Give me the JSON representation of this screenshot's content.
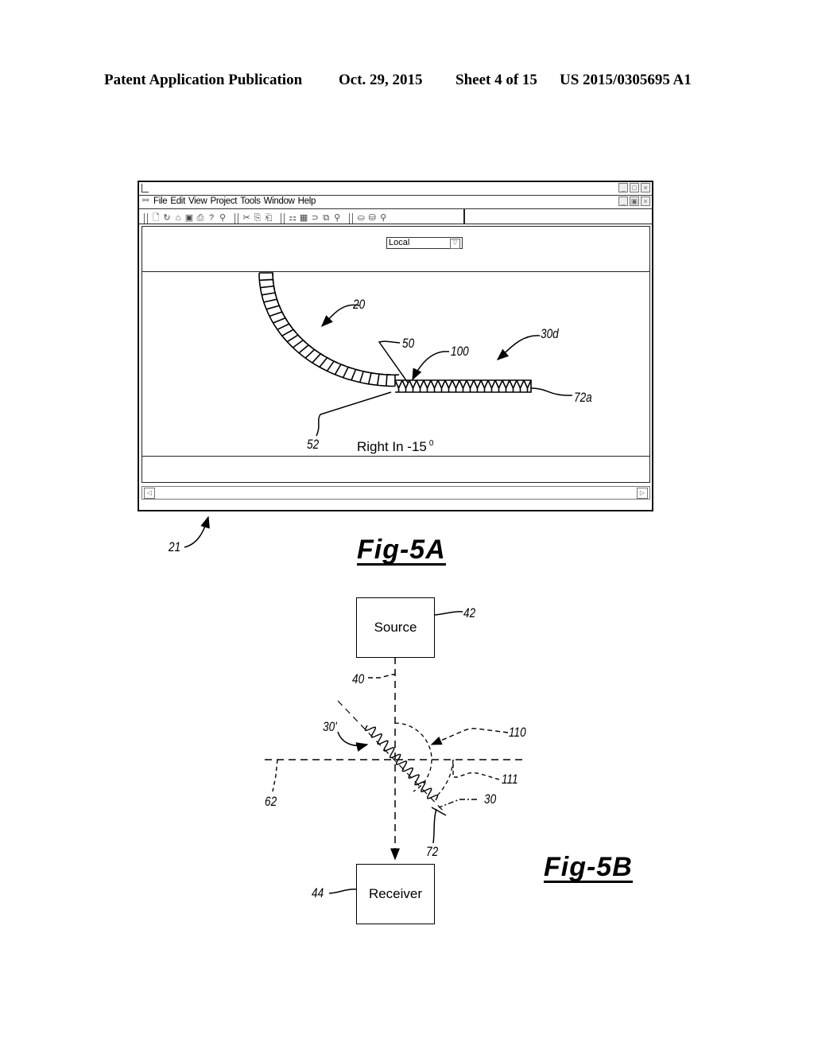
{
  "header": {
    "publication": "Patent Application Publication",
    "date": "Oct. 29, 2015",
    "sheet": "Sheet 4 of 15",
    "number": "US 2015/0305695 A1"
  },
  "fig5a": {
    "caption": "Fig-5A",
    "window": {
      "system_buttons": [
        "minimize",
        "maximize",
        "close"
      ],
      "menu": [
        "File",
        "Edit",
        "View",
        "Project",
        "Tools",
        "Window",
        "Help"
      ],
      "toolbar_groups": [
        [
          "new-icon",
          "open-icon",
          "open-folder-icon",
          "save-icon",
          "print-icon",
          "help-icon",
          "context-help-icon"
        ],
        [
          "cut-icon",
          "copy-icon",
          "paste-icon"
        ],
        [
          "hierarchy-icon",
          "grid-icon",
          "link-icon",
          "shapes-icon",
          "zoom-icon"
        ],
        [
          "tool-a-icon",
          "tool-b-icon",
          "pin-icon"
        ]
      ],
      "location_dropdown": "Local",
      "status_text": "Right In -15",
      "status_degree": "0"
    },
    "reference_labels": {
      "arm": "20",
      "curve": "30d",
      "point_50": "50",
      "point_100": "100",
      "end_72a": "72a",
      "point_52": "52",
      "window_21": "21"
    }
  },
  "fig5b": {
    "caption": "Fig-5B",
    "source_label": "Source",
    "receiver_label": "Receiver",
    "reference_labels": {
      "source": "42",
      "beam": "40",
      "coil": "30'",
      "arc_110": "110",
      "arc_111": "111",
      "axis": "62",
      "coil_30": "30",
      "end_72": "72",
      "receiver": "44"
    }
  }
}
